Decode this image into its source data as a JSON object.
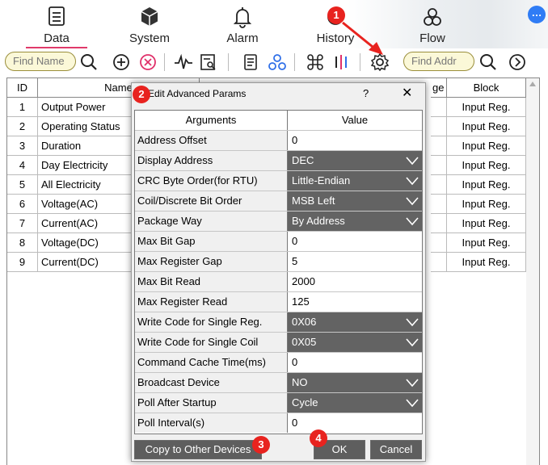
{
  "nav": {
    "tabs": [
      {
        "label": "Data",
        "icon": "list-icon",
        "active": true
      },
      {
        "label": "System",
        "icon": "cube-icon",
        "active": false
      },
      {
        "label": "Alarm",
        "icon": "bell-icon",
        "active": false
      },
      {
        "label": "History",
        "icon": "history-icon",
        "active": false
      },
      {
        "label": "Flow",
        "icon": "flow-icon",
        "active": false
      }
    ],
    "more_label": "…"
  },
  "toolbar": {
    "find_name_placeholder": "Find Name",
    "find_addr_placeholder": "Find Addr"
  },
  "table": {
    "headers": {
      "id": "ID",
      "name": "Name",
      "range": "ge",
      "block": "Block"
    },
    "rows": [
      {
        "id": "1",
        "name": "Output Power",
        "block": "Input Reg."
      },
      {
        "id": "2",
        "name": "Operating Status",
        "block": "Input Reg."
      },
      {
        "id": "3",
        "name": "Duration",
        "block": "Input Reg."
      },
      {
        "id": "4",
        "name": "Day Electricity",
        "block": "Input Reg."
      },
      {
        "id": "5",
        "name": "All Electricity",
        "block": "Input Reg."
      },
      {
        "id": "6",
        "name": "Voltage(AC)",
        "block": "Input Reg."
      },
      {
        "id": "7",
        "name": "Current(AC)",
        "block": "Input Reg."
      },
      {
        "id": "8",
        "name": "Voltage(DC)",
        "block": "Input Reg."
      },
      {
        "id": "9",
        "name": "Current(DC)",
        "block": "Input Reg."
      }
    ]
  },
  "dialog": {
    "title": "Edit Advanced Params",
    "help": "?",
    "close": "✕",
    "col_arguments": "Arguments",
    "col_value": "Value",
    "params": [
      {
        "arg": "Address Offset",
        "value": "0",
        "dropdown": false
      },
      {
        "arg": "Display Address",
        "value": "DEC",
        "dropdown": true
      },
      {
        "arg": "CRC Byte Order(for RTU)",
        "value": "Little-Endian",
        "dropdown": true
      },
      {
        "arg": "Coil/Discrete Bit Order",
        "value": "MSB Left",
        "dropdown": true
      },
      {
        "arg": "Package Way",
        "value": "By Address",
        "dropdown": true
      },
      {
        "arg": "Max Bit Gap",
        "value": "0",
        "dropdown": false
      },
      {
        "arg": "Max Register Gap",
        "value": "5",
        "dropdown": false
      },
      {
        "arg": "Max Bit Read",
        "value": "2000",
        "dropdown": false
      },
      {
        "arg": "Max Register Read",
        "value": "125",
        "dropdown": false
      },
      {
        "arg": "Write Code for Single Reg.",
        "value": "0X06",
        "dropdown": true
      },
      {
        "arg": "Write Code for Single Coil",
        "value": "0X05",
        "dropdown": true
      },
      {
        "arg": "Command Cache Time(ms)",
        "value": "0",
        "dropdown": false
      },
      {
        "arg": "Broadcast Device",
        "value": "NO",
        "dropdown": true
      },
      {
        "arg": "Poll After Startup",
        "value": "Cycle",
        "dropdown": true
      },
      {
        "arg": "Poll Interval(s)",
        "value": "0",
        "dropdown": false
      }
    ],
    "copy_button": "Copy to Other Devices",
    "ok_button": "OK",
    "cancel_button": "Cancel"
  },
  "markers": [
    "1",
    "2",
    "3",
    "4"
  ],
  "colors": {
    "marker": "#e8231f",
    "accent": "#e03a6a",
    "select_bg": "#636363",
    "search_pill_bg": "#fbf8d8"
  }
}
